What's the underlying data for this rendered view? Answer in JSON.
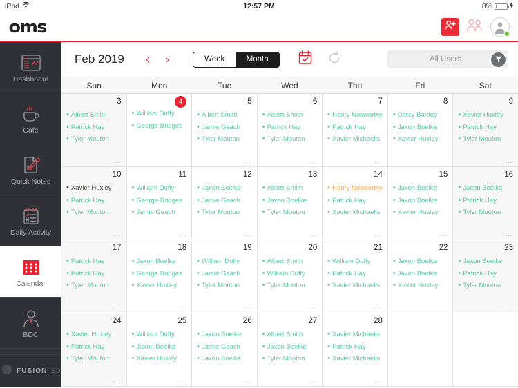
{
  "status_bar": {
    "device": "iPad",
    "wifi_icon": "wifi-icon",
    "time": "12:57 PM",
    "battery_percent": "8%"
  },
  "header": {
    "brand": "oms",
    "add_user_icon": "add-person-icon",
    "people_icon": "people-icon",
    "avatar_icon": "avatar-icon"
  },
  "sidebar": {
    "items": [
      {
        "label": "Dashboard",
        "icon": "dashboard-icon",
        "active": false
      },
      {
        "label": "Cafe",
        "icon": "coffee-cup-icon",
        "active": false
      },
      {
        "label": "Quick Notes",
        "icon": "note-pencil-icon",
        "active": false
      },
      {
        "label": "Daily Activity",
        "icon": "clipboard-checklist-icon",
        "active": false
      },
      {
        "label": "Calendar",
        "icon": "calendar-icon",
        "active": true
      },
      {
        "label": "BDC",
        "icon": "person-tie-icon",
        "active": false
      }
    ],
    "footer": {
      "brand": "FUSION",
      "suffix": "SD",
      "icon": "fusion-moon-icon"
    }
  },
  "toolbar": {
    "month_title": "Feb 2019",
    "prev_icon": "chevron-left-icon",
    "next_icon": "chevron-right-icon",
    "view_options": [
      "Week",
      "Month"
    ],
    "view_selected": "Month",
    "today_icon": "calendar-check-icon",
    "refresh_icon": "refresh-icon",
    "filter_value": "All Users",
    "filter_icon": "funnel-icon"
  },
  "weekdays": [
    "Sun",
    "Mon",
    "Tue",
    "Wed",
    "Thu",
    "Fri",
    "Sat"
  ],
  "colors": {
    "accent_red": "#e8222e",
    "event_green": "#5ec9a0",
    "event_orange": "#f5a85a",
    "event_dark": "#4e4540",
    "sidebar_bg": "#2f3136"
  },
  "overflow_indicator": "...",
  "weeks": [
    [
      {
        "day": "3",
        "weekend": true,
        "today": false,
        "overflow": true,
        "events": [
          {
            "name": "Albert Smith",
            "color": "green"
          },
          {
            "name": "Patrick Hay",
            "color": "green"
          },
          {
            "name": "Tyler Mouton",
            "color": "green"
          }
        ]
      },
      {
        "day": "4",
        "weekend": false,
        "today": true,
        "overflow": false,
        "events": [
          {
            "name": "William Duffy",
            "color": "green"
          },
          {
            "name": "George Bridges",
            "color": "green"
          }
        ]
      },
      {
        "day": "5",
        "weekend": false,
        "today": false,
        "overflow": true,
        "events": [
          {
            "name": "Albert Smith",
            "color": "green"
          },
          {
            "name": "Jamie Geach",
            "color": "green"
          },
          {
            "name": "Tyler Mouton",
            "color": "green"
          }
        ]
      },
      {
        "day": "6",
        "weekend": false,
        "today": false,
        "overflow": true,
        "events": [
          {
            "name": "Albert Smith",
            "color": "green"
          },
          {
            "name": "Patrick Hay",
            "color": "green"
          },
          {
            "name": "Tyler Mouton",
            "color": "green"
          }
        ]
      },
      {
        "day": "7",
        "weekend": false,
        "today": false,
        "overflow": true,
        "events": [
          {
            "name": "Henry Nosworthy",
            "color": "green"
          },
          {
            "name": "Patrick Hay",
            "color": "green"
          },
          {
            "name": "Xavier Michaelis",
            "color": "green"
          }
        ]
      },
      {
        "day": "8",
        "weekend": false,
        "today": false,
        "overflow": false,
        "events": [
          {
            "name": "Darcy Bartley",
            "color": "green"
          },
          {
            "name": "Jaxon Boelke",
            "color": "green"
          },
          {
            "name": "Xavier Huxley",
            "color": "green"
          }
        ]
      },
      {
        "day": "9",
        "weekend": true,
        "today": false,
        "overflow": true,
        "events": [
          {
            "name": "Xavier Huxley",
            "color": "green"
          },
          {
            "name": "Patrick Hay",
            "color": "green"
          },
          {
            "name": "Tyler Mouton",
            "color": "green"
          }
        ]
      }
    ],
    [
      {
        "day": "10",
        "weekend": true,
        "today": false,
        "overflow": true,
        "events": [
          {
            "name": "Xavier Huxley",
            "color": "dark"
          },
          {
            "name": "Patrick Hay",
            "color": "green"
          },
          {
            "name": "Tyler Mouton",
            "color": "green"
          }
        ]
      },
      {
        "day": "11",
        "weekend": false,
        "today": false,
        "overflow": true,
        "events": [
          {
            "name": "William Duffy",
            "color": "green"
          },
          {
            "name": "George Bridges",
            "color": "green"
          },
          {
            "name": "Jamie Geach",
            "color": "green"
          }
        ]
      },
      {
        "day": "12",
        "weekend": false,
        "today": false,
        "overflow": true,
        "events": [
          {
            "name": "Jaxon Boelke",
            "color": "green"
          },
          {
            "name": "Jamie Geach",
            "color": "green"
          },
          {
            "name": "Tyler Mouton",
            "color": "green"
          }
        ]
      },
      {
        "day": "13",
        "weekend": false,
        "today": false,
        "overflow": true,
        "events": [
          {
            "name": "Albert Smith",
            "color": "green"
          },
          {
            "name": "Jaxon Boelke",
            "color": "green"
          },
          {
            "name": "Tyler Mouton",
            "color": "green"
          }
        ]
      },
      {
        "day": "14",
        "weekend": false,
        "today": false,
        "overflow": true,
        "events": [
          {
            "name": "Henry Nosworthy",
            "color": "orange"
          },
          {
            "name": "Patrick Hay",
            "color": "green"
          },
          {
            "name": "Xavier Michaelis",
            "color": "green"
          }
        ]
      },
      {
        "day": "15",
        "weekend": false,
        "today": false,
        "overflow": true,
        "events": [
          {
            "name": "Jaxon Boelke",
            "color": "green"
          },
          {
            "name": "Jaxon Boelke",
            "color": "green"
          },
          {
            "name": "Xavier Huxley",
            "color": "green"
          }
        ]
      },
      {
        "day": "16",
        "weekend": true,
        "today": false,
        "overflow": true,
        "events": [
          {
            "name": "Jaxon Boelke",
            "color": "green"
          },
          {
            "name": "Patrick Hay",
            "color": "green"
          },
          {
            "name": "Tyler Mouton",
            "color": "green"
          }
        ]
      }
    ],
    [
      {
        "day": "17",
        "weekend": true,
        "today": false,
        "overflow": true,
        "events": [
          {
            "name": "Patrick Hay",
            "color": "green"
          },
          {
            "name": "Patrick Hay",
            "color": "green"
          },
          {
            "name": "Tyler Mouton",
            "color": "green"
          }
        ]
      },
      {
        "day": "18",
        "weekend": false,
        "today": false,
        "overflow": true,
        "events": [
          {
            "name": "Jaxon Boelke",
            "color": "green"
          },
          {
            "name": "George Bridges",
            "color": "green"
          },
          {
            "name": "Xavier Huxley",
            "color": "green"
          }
        ]
      },
      {
        "day": "19",
        "weekend": false,
        "today": false,
        "overflow": true,
        "events": [
          {
            "name": "William Duffy",
            "color": "green"
          },
          {
            "name": "Jamie Geach",
            "color": "green"
          },
          {
            "name": "Tyler Mouton",
            "color": "green"
          }
        ]
      },
      {
        "day": "20",
        "weekend": false,
        "today": false,
        "overflow": true,
        "events": [
          {
            "name": "Albert Smith",
            "color": "green"
          },
          {
            "name": "William Duffy",
            "color": "green"
          },
          {
            "name": "Tyler Mouton",
            "color": "green"
          }
        ]
      },
      {
        "day": "21",
        "weekend": false,
        "today": false,
        "overflow": true,
        "events": [
          {
            "name": "William Duffy",
            "color": "green"
          },
          {
            "name": "Patrick Hay",
            "color": "green"
          },
          {
            "name": "Xavier Michaelis",
            "color": "green"
          }
        ]
      },
      {
        "day": "22",
        "weekend": false,
        "today": false,
        "overflow": false,
        "events": [
          {
            "name": "Jaxon Boelke",
            "color": "green"
          },
          {
            "name": "Jaxon Boelke",
            "color": "green"
          },
          {
            "name": "Xavier Huxley",
            "color": "green"
          }
        ]
      },
      {
        "day": "23",
        "weekend": true,
        "today": false,
        "overflow": true,
        "events": [
          {
            "name": "Jaxon Boelke",
            "color": "green"
          },
          {
            "name": "Patrick Hay",
            "color": "green"
          },
          {
            "name": "Tyler Mouton",
            "color": "green"
          }
        ]
      }
    ],
    [
      {
        "day": "24",
        "weekend": true,
        "today": false,
        "overflow": true,
        "events": [
          {
            "name": "Xavier Huxley",
            "color": "green"
          },
          {
            "name": "Patrick Hay",
            "color": "green"
          },
          {
            "name": "Tyler Mouton",
            "color": "green"
          }
        ]
      },
      {
        "day": "25",
        "weekend": false,
        "today": false,
        "overflow": true,
        "events": [
          {
            "name": "William Duffy",
            "color": "green"
          },
          {
            "name": "Jaxon Boelke",
            "color": "green"
          },
          {
            "name": "Xavier Huxley",
            "color": "green"
          }
        ]
      },
      {
        "day": "26",
        "weekend": false,
        "today": false,
        "overflow": true,
        "events": [
          {
            "name": "Jaxon Boelke",
            "color": "green"
          },
          {
            "name": "Jamie Geach",
            "color": "green"
          },
          {
            "name": "Jaxon Boelke",
            "color": "green"
          }
        ]
      },
      {
        "day": "27",
        "weekend": false,
        "today": false,
        "overflow": true,
        "events": [
          {
            "name": "Albert Smith",
            "color": "green"
          },
          {
            "name": "Jaxon Boelke",
            "color": "green"
          },
          {
            "name": "Tyler Mouton",
            "color": "green"
          }
        ]
      },
      {
        "day": "28",
        "weekend": false,
        "today": false,
        "overflow": true,
        "events": [
          {
            "name": "Xavier Michaelis",
            "color": "green"
          },
          {
            "name": "Patrick Hay",
            "color": "green"
          },
          {
            "name": "Xavier Michaelis",
            "color": "green"
          }
        ]
      },
      {
        "day": "",
        "weekend": false,
        "today": false,
        "blank": true,
        "overflow": false,
        "events": []
      },
      {
        "day": "",
        "weekend": false,
        "today": false,
        "blank": true,
        "overflow": false,
        "events": []
      }
    ]
  ]
}
